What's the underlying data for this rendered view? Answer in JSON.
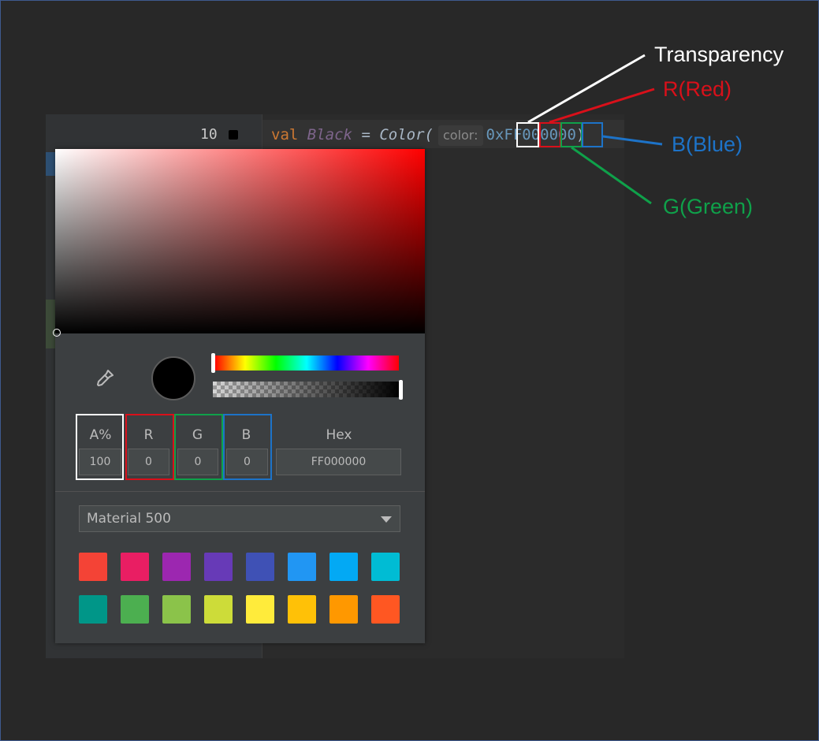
{
  "editor": {
    "line_number": "10",
    "code": {
      "keyword": "val",
      "identifier": "Black",
      "equals": "=",
      "function": "Color(",
      "param_hint": "color:",
      "value": "0xFF000000",
      "close": ")"
    }
  },
  "color_picker": {
    "fields": [
      {
        "label": "A%",
        "value": "100"
      },
      {
        "label": "R",
        "value": "0"
      },
      {
        "label": "G",
        "value": "0"
      },
      {
        "label": "B",
        "value": "0"
      },
      {
        "label": "Hex",
        "value": "FF000000"
      }
    ],
    "palette_select": "Material 500",
    "palette_colors": [
      "#f44336",
      "#e91e63",
      "#9c27b0",
      "#673ab7",
      "#3f51b5",
      "#2196f3",
      "#03a9f4",
      "#00bcd4",
      "#009688",
      "#4caf50",
      "#8bc34a",
      "#cddc39",
      "#ffeb3b",
      "#ffc107",
      "#ff9800",
      "#ff5722"
    ],
    "selected_color": "#000000"
  },
  "annotations": {
    "transparency": "Transparency",
    "red": "R(Red)",
    "blue": "B(Blue)",
    "green": "G(Green)",
    "colors": {
      "white": "#ffffff",
      "red": "#d9101a",
      "green": "#0fa14a",
      "blue": "#1d73c8"
    }
  }
}
